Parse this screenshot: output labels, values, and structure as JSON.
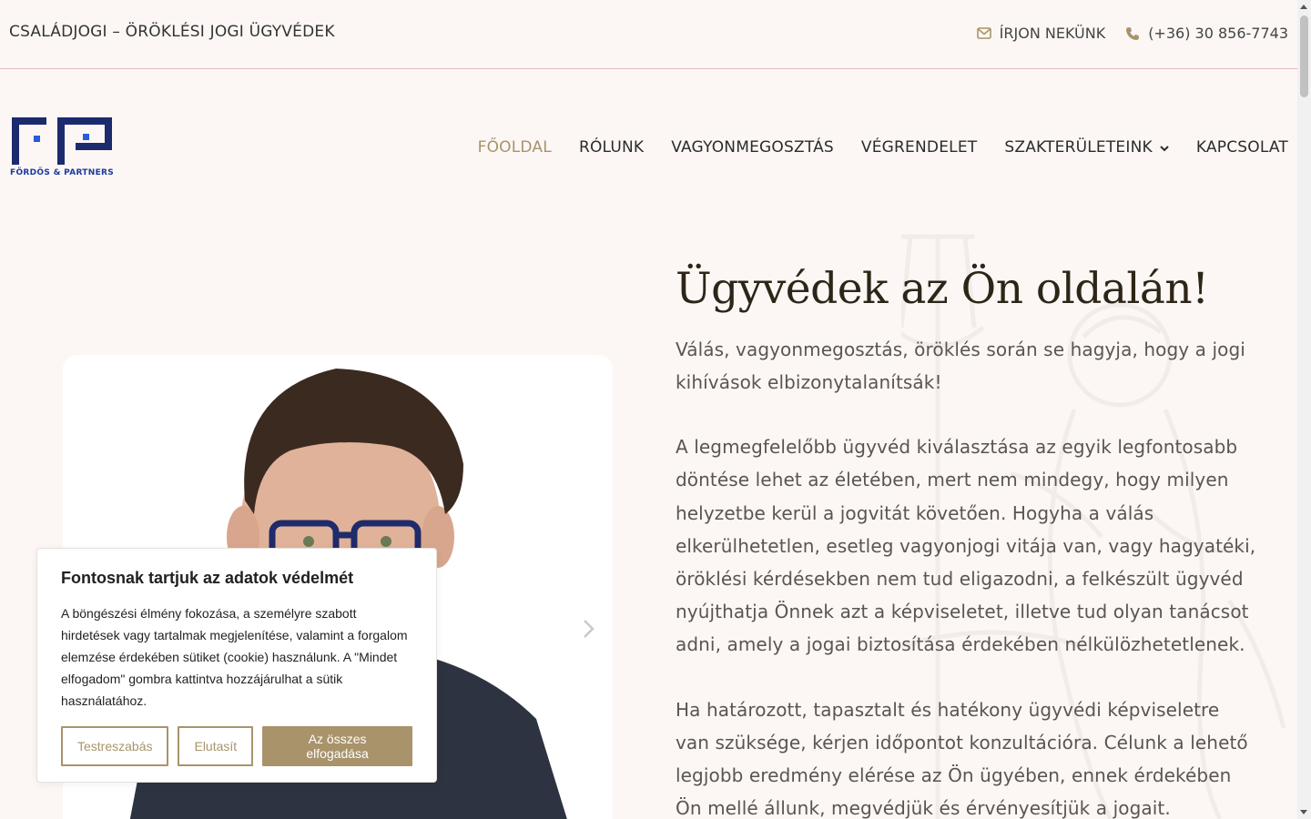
{
  "topbar": {
    "tagline": "CSALÁDJOGI – ÖRÖKLÉSI JOGI ÜGYVÉDEK",
    "email_label": "ÍRJON NEKÜNK",
    "phone_label": "(+36) 30 856-7743"
  },
  "logo": {
    "text": "FÖRDŐS & PARTNERS"
  },
  "nav": {
    "items": [
      {
        "label": "FŐOLDAL"
      },
      {
        "label": "RÓLUNK"
      },
      {
        "label": "VAGYONMEGOSZTÁS"
      },
      {
        "label": "VÉGRENDELET"
      },
      {
        "label": "SZAKTERÜLETEINK"
      },
      {
        "label": "KAPCSOLAT"
      }
    ]
  },
  "hero": {
    "title": "Ügyvédek az Ön oldalán!",
    "paragraphs": [
      "Válás, vagyonmegosztás, öröklés során se hagyja, hogy a jogi kihívások elbizonytalanítsák!",
      "A legmegfelelőbb ügyvéd kiválasztása az egyik legfontosabb döntése lehet az életében, mert nem mindegy, hogy milyen helyzetbe kerül a jogvitát követően. Hogyha a válás elkerülhetetlen, esetleg vagyonjogi vitája van, vagy hagyatéki, öröklési kérdésekben nem tud eligazodni, a felkészült ügyvéd nyújthatja Önnek azt a képviseletet, illetve tud olyan tanácsot adni, amely a jogai biztosítása érdekében nélkülözhetetlenek.",
      "Ha határozott, tapasztalt és hatékony ügyvédi képviseletre van szüksége, kérjen időpontot konzultációra. Célunk a lehető legjobb eredmény elérése az Ön ügyében, ennek érdekében Ön mellé állunk, megvédjük és érvényesítjük a jogait."
    ]
  },
  "cookie": {
    "title": "Fontosnak tartjuk az adatok védelmét",
    "text": "A böngészési élmény fokozása, a személyre szabott hirdetések vagy tartalmak megjelenítése, valamint a forgalom elemzése érdekében sütiket (cookie) használunk. A \"Mindet elfogadom\" gombra kattintva hozzájárulhat a sütik használatához.",
    "customize_label": "Testreszabás",
    "reject_label": "Elutasít",
    "accept_label": "Az összes elfogadása"
  },
  "colors": {
    "accent": "#a9936a",
    "background": "#fcf7f5",
    "logo": "#1c2a6e",
    "divider": "#e9b7c0"
  },
  "icons": [
    "envelope-icon",
    "phone-icon",
    "chevron-down-icon",
    "chevron-right-icon"
  ]
}
